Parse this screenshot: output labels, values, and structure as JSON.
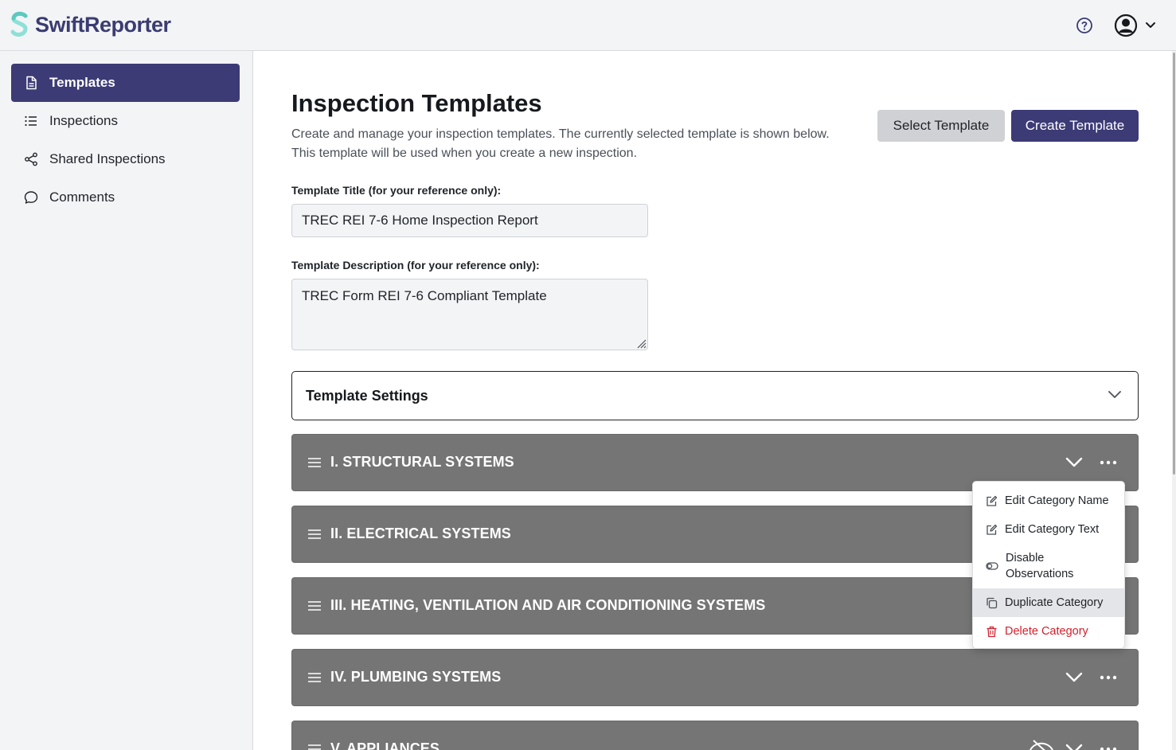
{
  "app": {
    "name": "SwiftReporter",
    "brand_color": "#3c3b76",
    "logo_accent": "#8ee0d7"
  },
  "header": {
    "help_icon": "question-circle-icon",
    "user_icon": "user-circle-icon"
  },
  "sidebar": {
    "items": [
      {
        "label": "Templates",
        "icon": "document-icon",
        "active": true
      },
      {
        "label": "Inspections",
        "icon": "list-icon",
        "active": false
      },
      {
        "label": "Shared Inspections",
        "icon": "share-icon",
        "active": false
      },
      {
        "label": "Comments",
        "icon": "comment-icon",
        "active": false
      }
    ]
  },
  "page": {
    "title": "Inspection Templates",
    "description": "Create and manage your inspection templates. The currently selected template is shown below. This template will be used when you create a new inspection.",
    "select_button": "Select Template",
    "create_button": "Create Template"
  },
  "form": {
    "title_label": "Template Title (for your reference only):",
    "title_value": "TREC REI 7-6 Home Inspection Report",
    "description_label": "Template Description (for your reference only):",
    "description_value": "TREC Form REI 7-6 Compliant Template"
  },
  "settings": {
    "label": "Template Settings"
  },
  "categories": [
    {
      "title": "I. STRUCTURAL SYSTEMS"
    },
    {
      "title": "II. ELECTRICAL SYSTEMS"
    },
    {
      "title": "III. HEATING, VENTILATION AND AIR CONDITIONING SYSTEMS"
    },
    {
      "title": "IV. PLUMBING SYSTEMS"
    },
    {
      "title": "V. APPLIANCES",
      "observations_disabled": true
    }
  ],
  "category_menu": {
    "items": [
      {
        "label": "Edit Category Name",
        "icon": "edit-icon"
      },
      {
        "label": "Edit Category Text",
        "icon": "edit-icon"
      },
      {
        "label": "Disable Observations",
        "icon": "toggle-icon"
      },
      {
        "label": "Duplicate Category",
        "icon": "copy-icon",
        "hovered": true
      },
      {
        "label": "Delete Category",
        "icon": "trash-icon",
        "danger": true
      }
    ]
  }
}
